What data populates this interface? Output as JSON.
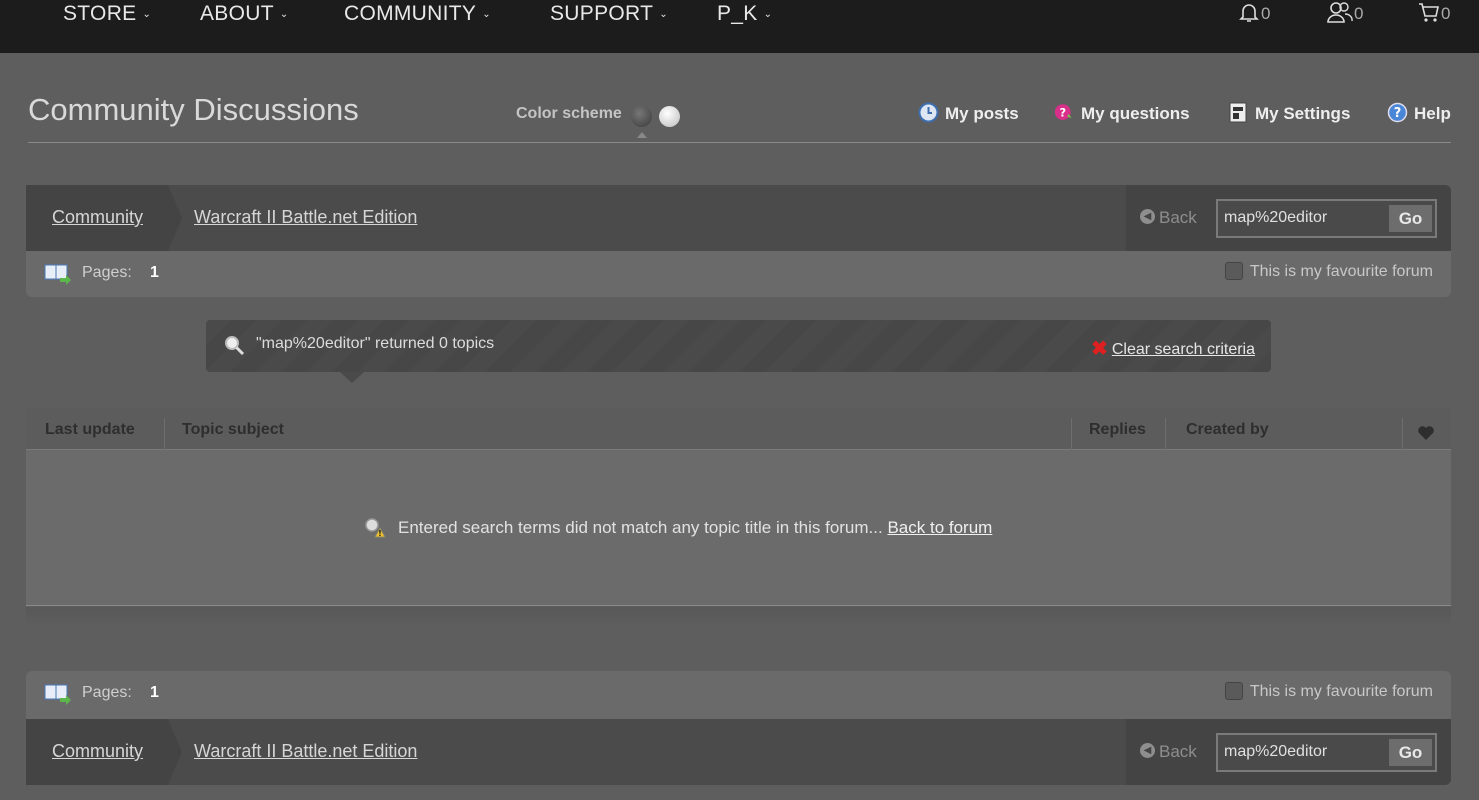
{
  "topnav": {
    "items": [
      {
        "label": "STORE"
      },
      {
        "label": "ABOUT"
      },
      {
        "label": "COMMUNITY"
      },
      {
        "label": "SUPPORT"
      },
      {
        "label": "P_K"
      }
    ],
    "notifications_count": "0",
    "friends_count": "0",
    "cart_count": "0"
  },
  "header": {
    "title": "Community Discussions",
    "color_scheme_label": "Color scheme",
    "links": {
      "my_posts": "My posts",
      "my_questions": "My questions",
      "my_settings": "My Settings",
      "help": "Help"
    }
  },
  "breadcrumb": {
    "root": "Community",
    "forum": "Warcraft II Battle.net Edition",
    "back_label": "Back",
    "search_value": "map%20editor",
    "go_label": "Go"
  },
  "pages": {
    "label": "Pages:",
    "current": "1",
    "favourite_label": "This is my favourite forum"
  },
  "search_banner": {
    "result_text": "\"map%20editor\" returned 0 topics",
    "clear_label": "Clear search criteria"
  },
  "table": {
    "columns": [
      "Last update",
      "Topic subject",
      "Replies",
      "Created by"
    ],
    "empty_message": "Entered search terms did not match any topic title in this forum...",
    "back_to_forum": "Back to forum"
  },
  "colors": {
    "background": "#5e5e5e",
    "nav_background": "#1c1c1c",
    "clear_icon": "#e02020"
  }
}
